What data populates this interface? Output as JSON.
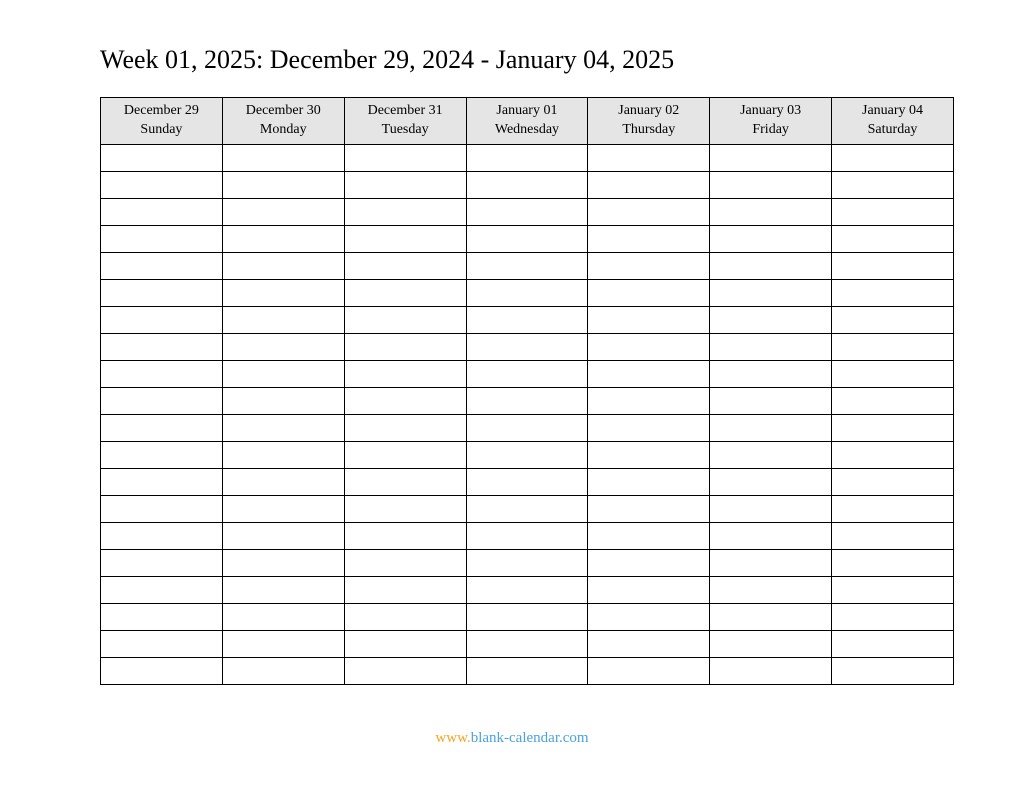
{
  "title": "Week 01, 2025: December 29, 2024 - January 04, 2025",
  "columns": [
    {
      "date": "December 29",
      "day": "Sunday"
    },
    {
      "date": "December 30",
      "day": "Monday"
    },
    {
      "date": "December 31",
      "day": "Tuesday"
    },
    {
      "date": "January 01",
      "day": "Wednesday"
    },
    {
      "date": "January 02",
      "day": "Thursday"
    },
    {
      "date": "January 03",
      "day": "Friday"
    },
    {
      "date": "January 04",
      "day": "Saturday"
    }
  ],
  "row_count": 20,
  "footer": {
    "www": "www.",
    "domain": "blank-calendar.com"
  }
}
